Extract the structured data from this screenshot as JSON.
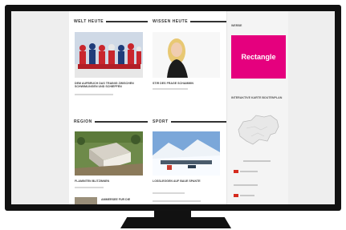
{
  "sections": {
    "welt_heute": "WELT HEUTE",
    "wissen_heute": "WISSEN HEUTE",
    "region": "REGION",
    "sport": "SPORT"
  },
  "articles": {
    "welt": "DEM AUFBRUCH DAS TRAINIG ZWISCHEN SCHWIMLINGEN UND SCHIEFFEN",
    "wissen": "STIR DES FRAGE SCHAMMIN",
    "region": "FLAMINTEN BLITZINNEN",
    "sport": "LOSSLEGGEN AUF BAUE SPANTE",
    "bottom": "AMMERSEE FUR DIE"
  },
  "sidebar": {
    "top_label": "WERBE",
    "ad_label": "Rectangle",
    "widget_title": "INTERAKTIVE KARTE BOUTENPLAN",
    "ad_color": "#e5007e"
  }
}
